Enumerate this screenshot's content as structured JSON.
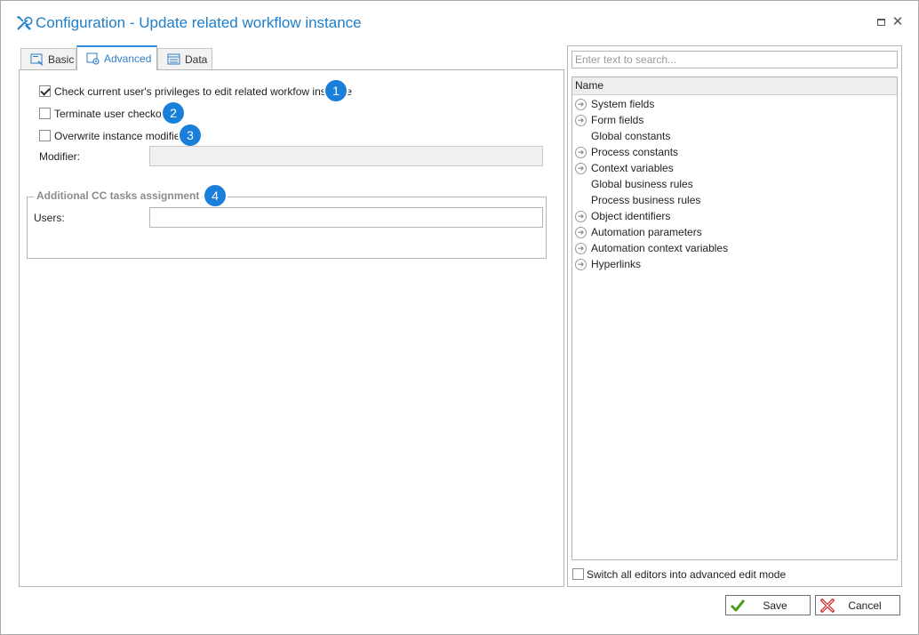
{
  "window": {
    "title": "Configuration - Update related workflow instance"
  },
  "tabs": [
    {
      "label": "Basic",
      "icon": "basic-tab-icon"
    },
    {
      "label": "Advanced",
      "icon": "advanced-tab-icon",
      "active": true
    },
    {
      "label": "Data",
      "icon": "data-tab-icon"
    }
  ],
  "advanced": {
    "check_privileges": {
      "label": "Check current user's privileges to edit related workfow instance",
      "checked": true,
      "badge": "1"
    },
    "terminate_checkout": {
      "label": "Terminate user checkout",
      "checked": false,
      "badge": "2"
    },
    "overwrite_modifier": {
      "label": "Overwrite instance modifier",
      "checked": false,
      "badge": "3"
    },
    "modifier_label": "Modifier:",
    "modifier_value": "",
    "cc_group": {
      "legend": "Additional CC tasks assignment",
      "badge": "4",
      "users_label": "Users:",
      "users_value": ""
    }
  },
  "right_panel": {
    "search_placeholder": "Enter text to search...",
    "column_header": "Name",
    "items": [
      {
        "label": "System fields",
        "expandable": true
      },
      {
        "label": "Form fields",
        "expandable": true
      },
      {
        "label": "Global constants",
        "expandable": false
      },
      {
        "label": "Process constants",
        "expandable": true
      },
      {
        "label": "Context variables",
        "expandable": true
      },
      {
        "label": "Global business rules",
        "expandable": false
      },
      {
        "label": "Process business rules",
        "expandable": false
      },
      {
        "label": "Object identifiers",
        "expandable": true
      },
      {
        "label": "Automation parameters",
        "expandable": true
      },
      {
        "label": "Automation context variables",
        "expandable": true
      },
      {
        "label": "Hyperlinks",
        "expandable": true
      }
    ],
    "advanced_mode": {
      "label": "Switch all editors into advanced edit mode",
      "checked": false
    }
  },
  "footer": {
    "save_label": "Save",
    "cancel_label": "Cancel"
  },
  "colors": {
    "accent": "#1e7ec8",
    "badge": "#1a7fd8"
  }
}
